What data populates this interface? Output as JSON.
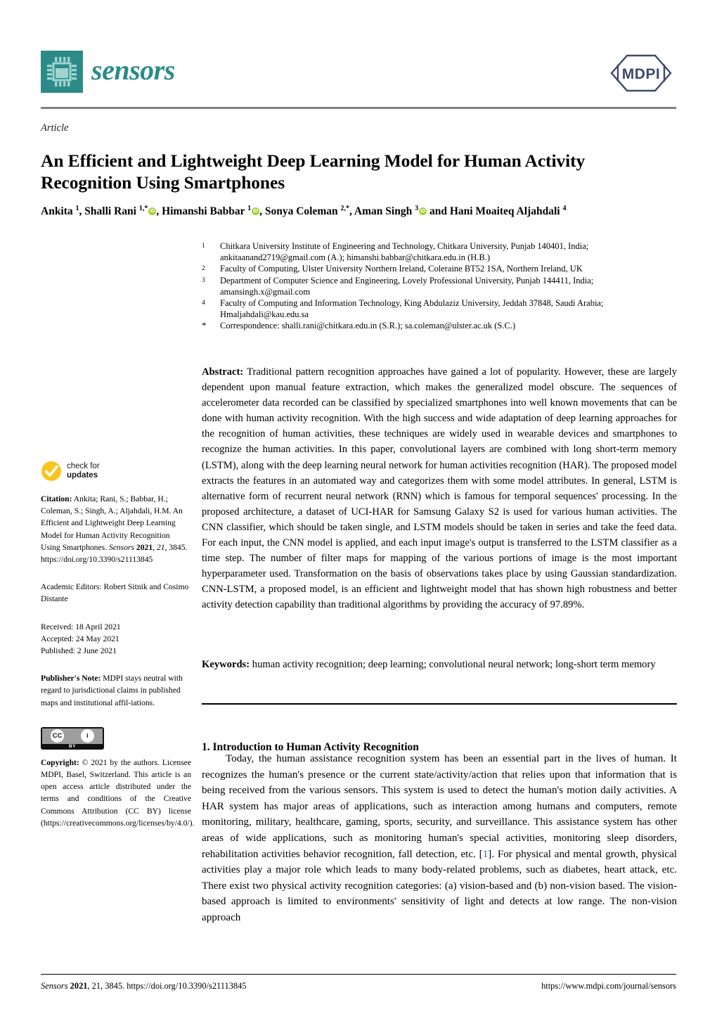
{
  "journal": {
    "name": "sensors",
    "logo_icon": "microchip-icon",
    "publisher_logo_text": "MDPI",
    "brand_color": "#2d8b87",
    "publisher_color": "#3d4a6b"
  },
  "article": {
    "kind": "Article",
    "title": "An Efficient and Lightweight Deep Learning Model for Human Activity Recognition Using Smartphones"
  },
  "authors": {
    "list": "Ankita 1, Shalli Rani 1,*, Himanshi Babbar 1, Sonya Coleman 2,*, Aman Singh 3 and Hani Moaiteq Aljahdali 4",
    "orcid_label": "iD"
  },
  "affiliations": [
    {
      "mark": "1",
      "text": "Chitkara University Institute of Engineering and Technology, Chitkara University, Punjab 140401, India; ankitaanand2719@gmail.com (A.); himanshi.babbar@chitkara.edu.in (H.B.)"
    },
    {
      "mark": "2",
      "text": "Faculty of Computing, Ulster University Northern Ireland, Coleraine BT52 1SA, Northern Ireland, UK"
    },
    {
      "mark": "3",
      "text": "Department of Computer Science and Engineering, Lovely Professional University, Punjab 144411, India; amansingh.x@gmail.com"
    },
    {
      "mark": "4",
      "text": "Faculty of Computing and Information Technology, King Abdulaziz University, Jeddah 37848, Saudi Arabia; Hmaljahdali@kau.edu.sa"
    },
    {
      "mark": "*",
      "text": "Correspondence: shalli.rani@chitkara.edu.in (S.R.); sa.coleman@ulster.ac.uk (S.C.)"
    }
  ],
  "abstract": {
    "label": "Abstract:",
    "text": "Traditional pattern recognition approaches have gained a lot of popularity. However, these are largely dependent upon manual feature extraction, which makes the generalized model obscure. The sequences of accelerometer data recorded can be classified by specialized smartphones into well known movements that can be done with human activity recognition. With the high success and wide adaptation of deep learning approaches for the recognition of human activities, these techniques are widely used in wearable devices and smartphones to recognize the human activities. In this paper, convolutional layers are combined with long short-term memory (LSTM), along with the deep learning neural network for human activities recognition (HAR). The proposed model extracts the features in an automated way and categorizes them with some model attributes. In general, LSTM is alternative form of recurrent neural network (RNN) which is famous for temporal sequences' processing. In the proposed architecture, a dataset of UCI-HAR for Samsung Galaxy S2 is used for various human activities. The CNN classifier, which should be taken single, and LSTM models should be taken in series and take the feed data. For each input, the CNN model is applied, and each input image's output is transferred to the LSTM classifier as a time step. The number of filter maps for mapping of the various portions of image is the most important hyperparameter used. Transformation on the basis of observations takes place by using Gaussian standardization. CNN-LSTM, a proposed model, is an efficient and lightweight model that has shown high robustness and better activity detection capability than traditional algorithms by providing the accuracy of 97.89%."
  },
  "keywords": {
    "label": "Keywords:",
    "text": "human activity recognition; deep learning; convolutional neural network; long-short term memory"
  },
  "introduction": {
    "heading": "1. Introduction to Human Activity Recognition",
    "paragraph_part1": "Today, the human assistance recognition system has been an essential part in the lives of human. It recognizes the human's presence or the current state/activity/action that relies upon that information that is being received from the various sensors. This system is used to detect the human's motion daily activities. A HAR system has major areas of applications, such as interaction among humans and computers, remote monitoring, military, healthcare, gaming, sports, security, and surveillance. This assistance system has other areas of wide applications, such as monitoring human's special activities, monitoring sleep disorders, rehabilitation activities behavior recognition, fall detection, etc. [",
    "reference_number": "1",
    "paragraph_part2": "]. For physical and mental growth, physical activities play a major role which leads to many body-related problems, such as diabetes, heart attack, etc. There exist two physical activity recognition categories: (a) vision-based and (b) non-vision based. The vision-based approach is limited to environments' sensitivity of light and detects at low range. The non-vision approach"
  },
  "sidebar": {
    "check_updates": {
      "line1": "check for",
      "line2": "updates",
      "icon": "checkmark-circle-icon",
      "color": "#f7c51e"
    },
    "citation": {
      "label": "Citation:",
      "text_before_journal": " Ankita; Rani, S.; Babbar, H.; Coleman, S.; Singh, A.; Aljahdali, H.M. An Efficient and Lightweight Deep Learning Model for Human Activity Recognition Using Smartphones. ",
      "journal": "Sensors",
      "year": "2021",
      "volume": "21",
      "article_no": "3845",
      "doi": "https://doi.org/10.3390/s21113845"
    },
    "academic_editors": "Academic Editors: Robert Sitnik and Cosimo Distante",
    "dates": {
      "received": "Received: 18 April 2021",
      "accepted": "Accepted: 24 May 2021",
      "published": "Published: 2 June 2021"
    },
    "publisher_note": {
      "label": "Publisher's Note:",
      "text": " MDPI stays neutral with regard to jurisdictional claims in published maps and institutional affil-iations."
    },
    "license_badge": {
      "cc": "CC",
      "by": "BY",
      "person_glyph": "i"
    },
    "copyright": {
      "label": "Copyright:",
      "text": " © 2021 by the authors. Licensee MDPI, Basel, Switzerland. This article is an open access article distributed under the terms and conditions of the Creative Commons Attribution (CC BY) license (https://creativecommons.org/licenses/by/4.0/)."
    }
  },
  "footer": {
    "left_journal": "Sensors",
    "left_year": "2021",
    "left_rest": ", 21, 3845. https://doi.org/10.3390/s21113845",
    "right": "https://www.mdpi.com/journal/sensors"
  }
}
